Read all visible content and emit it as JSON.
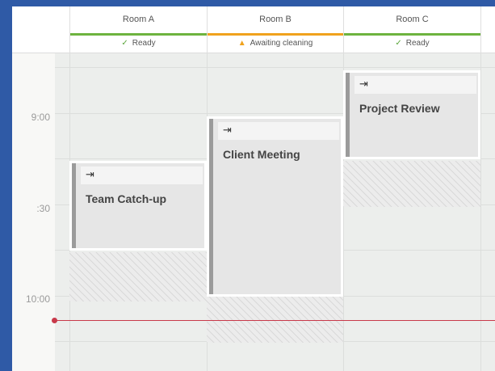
{
  "rooms": [
    {
      "name": "Room A",
      "status": "Ready",
      "status_icon": "check-icon",
      "status_color": "#5aa63a"
    },
    {
      "name": "Room B",
      "status": "Awaiting cleaning",
      "status_icon": "warning-icon",
      "status_color": "#f0a21d"
    },
    {
      "name": "Room C",
      "status": "Ready",
      "status_icon": "check-icon",
      "status_color": "#5aa63a"
    }
  ],
  "times": [
    "9:00",
    ":30",
    "10:00"
  ],
  "events": [
    {
      "room": "Room A",
      "title": "Team Catch-up",
      "icon": "arrow-to-end-icon",
      "icon_glyph": "⇥"
    },
    {
      "room": "Room B",
      "title": "Client Meeting",
      "icon": "arrow-to-end-icon",
      "icon_glyph": "⇥"
    },
    {
      "room": "Room C",
      "title": "Project Review",
      "icon": "arrow-to-end-icon",
      "icon_glyph": "⇥"
    }
  ],
  "colors": {
    "background": "#2f5aa6",
    "now_indicator": "#c8394a",
    "ready": "#5aa63a",
    "warning": "#f0a21d"
  }
}
